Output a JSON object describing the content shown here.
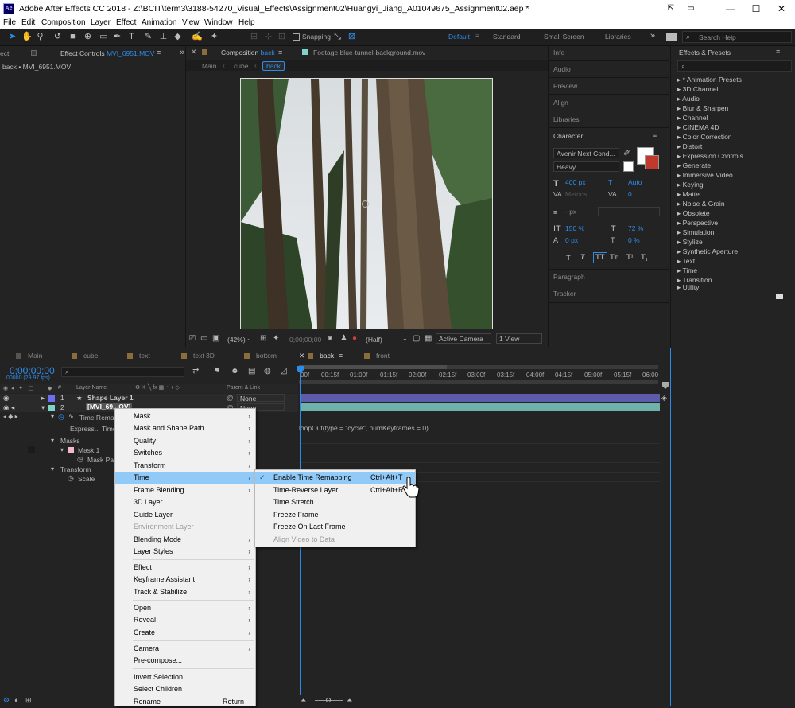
{
  "window": {
    "title": "Adobe After Effects CC 2018 - Z:\\BCIT\\term3\\3188-54270_Visual_Effects\\Assignment02\\Huangyi_Jiang_A01049675_Assignment02.aep *",
    "app_icon": "Ae"
  },
  "menu": [
    "File",
    "Edit",
    "Composition",
    "Layer",
    "Effect",
    "Animation",
    "View",
    "Window",
    "Help"
  ],
  "toolbar": {
    "snapping_label": "Snapping",
    "workspaces": [
      "Default",
      "Standard",
      "Small Screen",
      "Libraries"
    ],
    "search_placeholder": "Search Help"
  },
  "effect_controls": {
    "tab_label": "Effect Controls",
    "tab_file": "MVI_6951.MOV",
    "cut_label": "ect",
    "breadcrumb": "back • MVI_6951.MOV"
  },
  "composition": {
    "tab_label": "Composition",
    "tab_name": "back",
    "footage_label": "Footage",
    "footage_name": "blue-tunnel-background.mov",
    "breadcrumbs": [
      "Main",
      "cube",
      "back"
    ],
    "zoom": "(42%)",
    "timecode": "0;00;00;00",
    "resolution": "(Half)",
    "camera": "Active Camera",
    "view": "1 View"
  },
  "right_panels": {
    "items": [
      "Info",
      "Audio",
      "Preview",
      "Align",
      "Libraries"
    ],
    "character": {
      "title": "Character",
      "font": "Avenir Next Cond...",
      "style": "Heavy",
      "size": "400 px",
      "leading": "Auto",
      "kerning_label": "Metrics",
      "tracking": "0",
      "stroke_px": "- px",
      "vscale": "150 %",
      "hscale": "72 %",
      "baseline": "0 px",
      "tsume": "0 %",
      "style_buttons": [
        "T",
        "T",
        "TT",
        "Tт",
        "T¹",
        "T₁"
      ]
    },
    "bottom_items": [
      "Paragraph",
      "Tracker"
    ]
  },
  "effects_presets": {
    "title": "Effects & Presets",
    "search_placeholder": "⌕",
    "items": [
      "* Animation Presets",
      "3D Channel",
      "Audio",
      "Blur & Sharpen",
      "Channel",
      "CINEMA 4D",
      "Color Correction",
      "Distort",
      "Expression Controls",
      "Generate",
      "Immersive Video",
      "Keying",
      "Matte",
      "Noise & Grain",
      "Obsolete",
      "Perspective",
      "Simulation",
      "Stylize",
      "Synthetic Aperture",
      "Text",
      "Time",
      "Transition",
      "Utility"
    ]
  },
  "timeline": {
    "tabs": [
      "Main",
      "cube",
      "text",
      "text 3D",
      "bottom",
      "back",
      "front"
    ],
    "active_tab": "back",
    "timecode": "0;00;00;00",
    "fps": "00000 (29.97 fps)",
    "search_placeholder": "⌕",
    "col_headers": {
      "num": "#",
      "name": "Layer Name",
      "parent": "Parent & Link"
    },
    "ruler": [
      "00f",
      "00:15f",
      "01:00f",
      "01:15f",
      "02:00f",
      "02:15f",
      "03:00f",
      "03:15f",
      "04:00f",
      "04:15f",
      "05:00f",
      "05:15f",
      "06:00"
    ],
    "layers": [
      {
        "num": "1",
        "name": "Shape Layer 1",
        "parent": "None",
        "color": "#6e6ef0"
      },
      {
        "num": "2",
        "name": "[MVI_69...OV]",
        "parent": "None",
        "color": "#7fd3c9"
      }
    ],
    "props": {
      "time_remap": "Time Rema...",
      "expression": "Express... Time",
      "masks": "Masks",
      "mask1": "Mask 1",
      "mask_path": "Mask Pa...",
      "transform": "Transform",
      "scale": "Scale"
    },
    "expression_text": "loopOut(type = \"cycle\", numKeyframes = 0)"
  },
  "context_menu": {
    "items": [
      {
        "label": "Mask",
        "sub": true
      },
      {
        "label": "Mask and Shape Path",
        "sub": true
      },
      {
        "label": "Quality",
        "sub": true
      },
      {
        "label": "Switches",
        "sub": true
      },
      {
        "label": "Transform",
        "sub": true
      },
      {
        "label": "Time",
        "sub": true
      },
      {
        "label": "Frame Blending",
        "sub": true
      },
      {
        "label": "3D Layer"
      },
      {
        "label": "Guide Layer"
      },
      {
        "label": "Environment Layer",
        "disabled": true
      },
      {
        "label": "Blending Mode",
        "sub": true
      },
      {
        "label": "Layer Styles",
        "sub": true
      },
      {
        "label": "Effect",
        "sub": true
      },
      {
        "label": "Keyframe Assistant",
        "sub": true
      },
      {
        "label": "Track & Stabilize",
        "sub": true
      },
      {
        "label": "Open",
        "sub": true
      },
      {
        "label": "Reveal",
        "sub": true
      },
      {
        "label": "Create",
        "sub": true
      },
      {
        "label": "Camera",
        "sub": true
      },
      {
        "label": "Pre-compose..."
      },
      {
        "label": "Invert Selection"
      },
      {
        "label": "Select Children"
      },
      {
        "label": "Rename",
        "shortcut": "Return"
      }
    ],
    "highlighted": "Time"
  },
  "time_submenu": {
    "items": [
      {
        "label": "Enable Time Remapping",
        "shortcut": "Ctrl+Alt+T",
        "checked": true
      },
      {
        "label": "Time-Reverse Layer",
        "shortcut": "Ctrl+Alt+R"
      },
      {
        "label": "Time Stretch..."
      },
      {
        "label": "Freeze Frame"
      },
      {
        "label": "Freeze On Last Frame"
      },
      {
        "label": "Align Video to Data",
        "disabled": true
      }
    ]
  },
  "colors": {
    "accent": "#2d8ceb",
    "menu_highlight": "#91c9f7",
    "panel_bg": "#232323"
  }
}
